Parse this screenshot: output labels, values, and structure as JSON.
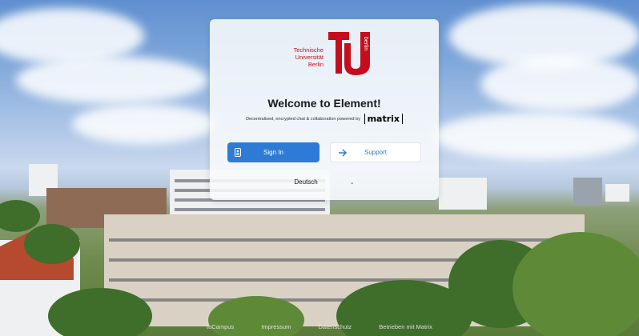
{
  "brand": {
    "name_line1": "Technische",
    "name_line2": "Universität",
    "name_line3": "Berlin",
    "logo_vertical": "berlin",
    "logo_color": "#c40d1e"
  },
  "welcome": {
    "title": "Welcome to Element!",
    "subtitle": "Decentralised, encrypted chat & collaboration powered by",
    "matrix_label": "matrix"
  },
  "buttons": {
    "sign_in": "Sign In",
    "sign_in_icon": "user-badge-icon",
    "support": "Support",
    "support_icon": "arrow-right-icon",
    "primary_color": "#2e7bd6"
  },
  "language": {
    "selected": "Deutsch"
  },
  "footer": {
    "links": [
      "tuCampus",
      "Impressum",
      "Datenschutz",
      "Betrieben mit Matrix"
    ]
  }
}
